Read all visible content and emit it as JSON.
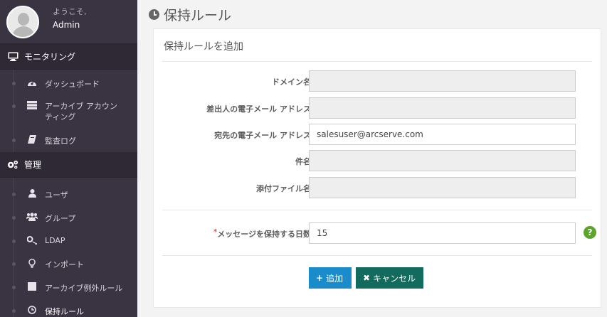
{
  "user": {
    "welcome": "ようこそ,",
    "name": "Admin"
  },
  "sidebar": {
    "monitoring": {
      "label": "モニタリング",
      "items": [
        {
          "label": "ダッシュボード",
          "icon": "dashboard-icon"
        },
        {
          "label": "アーカイブ アカウンティング",
          "icon": "server-icon"
        },
        {
          "label": "監査ログ",
          "icon": "book-icon"
        }
      ]
    },
    "management": {
      "label": "管理",
      "items": [
        {
          "label": "ユーザ",
          "icon": "user-icon"
        },
        {
          "label": "グループ",
          "icon": "users-icon"
        },
        {
          "label": "LDAP",
          "icon": "key-icon"
        },
        {
          "label": "インポート",
          "icon": "lightbulb-icon"
        },
        {
          "label": "アーカイブ例外ルール",
          "icon": "square-icon"
        },
        {
          "label": "保持ルール",
          "icon": "clock-icon"
        }
      ]
    }
  },
  "page": {
    "title": "保持ルール"
  },
  "panel": {
    "title": "保持ルールを追加"
  },
  "form": {
    "domain": {
      "label": "ドメイン名",
      "value": ""
    },
    "sender": {
      "label": "差出人の電子メール アドレス",
      "value": ""
    },
    "recipient": {
      "label": "宛先の電子メール アドレス",
      "value": "salesuser@arcserve.com"
    },
    "subject": {
      "label": "件名",
      "value": ""
    },
    "attachment": {
      "label": "添付ファイル名",
      "value": ""
    },
    "retention": {
      "required_mark": "*",
      "label": "メッセージを保持する日数",
      "value": "15"
    }
  },
  "buttons": {
    "add": "追加",
    "add_icon": "+",
    "cancel": "キャンセル",
    "cancel_icon": "✖"
  },
  "help_glyph": "?",
  "colors": {
    "sidebar": "#3a3342",
    "primary": "#1a8ccb",
    "cancel": "#136b5e",
    "help": "#5aa52a"
  }
}
